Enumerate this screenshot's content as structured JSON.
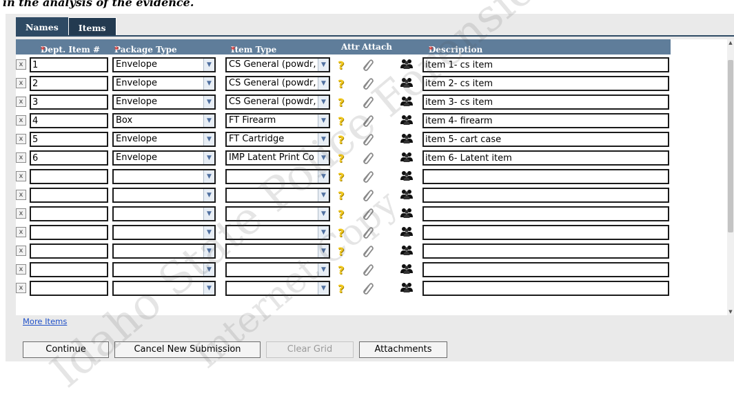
{
  "caption": "in the analysis of the evidence.",
  "tabs": [
    "Names",
    "Items"
  ],
  "headers": {
    "dept_item": "Dept. Item #",
    "package_type": "Package Type",
    "item_type": "Item Type",
    "attr": "Attr",
    "attach": "Attach",
    "description": "Description",
    "required_mark": "*"
  },
  "rows": [
    {
      "dept_item": "1",
      "package_type": "Envelope",
      "item_type": "CS General (powdr,",
      "description": "item 1- cs item"
    },
    {
      "dept_item": "2",
      "package_type": "Envelope",
      "item_type": "CS General (powdr,",
      "description": "item 2- cs item"
    },
    {
      "dept_item": "3",
      "package_type": "Envelope",
      "item_type": "CS General (powdr,",
      "description": "item 3- cs item"
    },
    {
      "dept_item": "4",
      "package_type": "Box",
      "item_type": "FT Firearm",
      "description": "item 4- firearm"
    },
    {
      "dept_item": "5",
      "package_type": "Envelope",
      "item_type": "FT Cartridge",
      "description": "item 5- cart case"
    },
    {
      "dept_item": "6",
      "package_type": "Envelope",
      "item_type": "IMP Latent Print Co",
      "description": "item 6- Latent item"
    },
    {
      "dept_item": "",
      "package_type": "",
      "item_type": "",
      "description": ""
    },
    {
      "dept_item": "",
      "package_type": "",
      "item_type": "",
      "description": ""
    },
    {
      "dept_item": "",
      "package_type": "",
      "item_type": "",
      "description": ""
    },
    {
      "dept_item": "",
      "package_type": "",
      "item_type": "",
      "description": ""
    },
    {
      "dept_item": "",
      "package_type": "",
      "item_type": "",
      "description": ""
    },
    {
      "dept_item": "",
      "package_type": "",
      "item_type": "",
      "description": ""
    },
    {
      "dept_item": "",
      "package_type": "",
      "item_type": "",
      "description": ""
    }
  ],
  "delete_label": "x",
  "attr_icon": "help-question-icon",
  "attach_icon": "paperclip-icon",
  "names_icon": "people-icon",
  "more_items": "More Items",
  "buttons": {
    "continue": "Continue",
    "cancel": "Cancel New Submission",
    "clear": "Clear Grid",
    "attachments": "Attachments"
  },
  "watermark": [
    "Idaho State Police Forensic Services",
    "Internet Copy"
  ],
  "colors": {
    "header_bg": "#5f7d9a",
    "tab_bg": "#2e4a64",
    "required": "#e0241c",
    "link": "#1f50c8"
  }
}
